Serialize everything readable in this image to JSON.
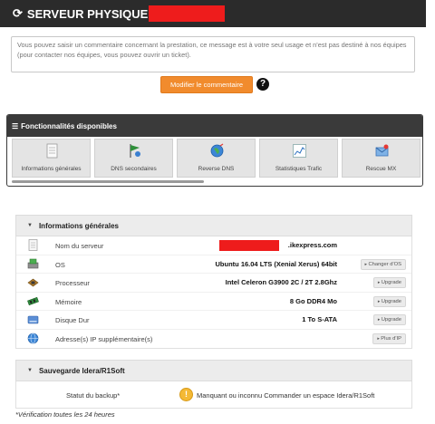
{
  "header": {
    "title": "SERVEUR PHYSIQUE",
    "refresh_icon": "refresh-icon",
    "redaction_color": "#ee1c1c"
  },
  "comment": {
    "placeholder": "Vous pouvez saisir un commentaire concernant la prestation, ce message est à votre seul usage et n'est pas destiné à nos équipes (pour contacter nos équipes, vous pouvez ouvrir un ticket)."
  },
  "actions": {
    "modify_label": "Modifier le commentaire",
    "help_glyph": "?",
    "accent_color": "#f18b2d"
  },
  "features": {
    "title": "Fonctionnalités disponibles",
    "tiles": [
      {
        "label": "Informations générales",
        "icon": "document-icon"
      },
      {
        "label": "DNS secondaires",
        "icon": "flag-icon"
      },
      {
        "label": "Reverse DNS",
        "icon": "globe-icon"
      },
      {
        "label": "Statistiques Trafic",
        "icon": "chart-icon"
      },
      {
        "label": "Rescue MX",
        "icon": "envelope-icon"
      }
    ]
  },
  "info": {
    "title": "Informations générales",
    "rows": [
      {
        "label": "Nom du serveur",
        "value": ".ikexpress.com",
        "icon": "document-icon",
        "button": ""
      },
      {
        "label": "OS",
        "value": "Ubuntu 16.04 LTS (Xenial Xerus) 64bit",
        "icon": "disk-install-icon",
        "button": "Changer d'OS"
      },
      {
        "label": "Processeur",
        "value": "Intel Celeron G3900 2C / 2T 2.8Ghz",
        "icon": "processor-icon",
        "button": "Upgrade"
      },
      {
        "label": "Mémoire",
        "value": "8 Go DDR4 Mo",
        "icon": "memory-icon",
        "button": "Upgrade"
      },
      {
        "label": "Disque Dur",
        "value": "1 To S-ATA",
        "icon": "hard-drive-icon",
        "button": "Upgrade"
      },
      {
        "label": "Adresse(s) IP supplémentaire(s)",
        "value": "",
        "icon": "network-icon",
        "button": "Plus d'IP"
      }
    ]
  },
  "backup": {
    "title": "Sauvegarde Idera/R1Soft",
    "label": "Statut du backup*",
    "warn_glyph": "!",
    "status": "Manquant ou inconnu Commander un espace Idera/R1Soft"
  },
  "footnote": "*Vérification toutes les 24 heures"
}
